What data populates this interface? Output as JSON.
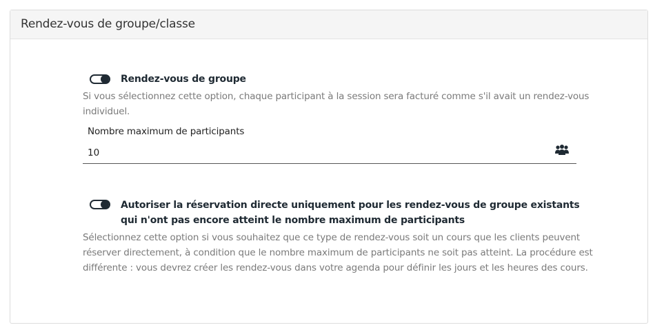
{
  "panel": {
    "title": "Rendez-vous de groupe/classe"
  },
  "group_option": {
    "enabled": true,
    "label": "Rendez-vous de groupe",
    "description_line1": "Si vous sélectionnez cette option, chaque participant à la session sera facturé comme s'il avait un rendez-vous",
    "description_line2": "individuel."
  },
  "max_participants": {
    "label": "Nombre maximum de participants",
    "value": "10",
    "icon": "users-icon"
  },
  "direct_booking_option": {
    "enabled": true,
    "label_line1": "Autoriser la réservation directe uniquement pour les rendez-vous de groupe existants",
    "label_line2": "qui n'ont pas encore atteint le nombre maximum de participants",
    "description_line1": "Sélectionnez cette option si vous souhaitez que ce type de rendez-vous soit un cours que les clients peuvent",
    "description_line2": "réserver directement, à condition que le nombre maximum de participants ne soit pas atteint. La procédure est",
    "description_line3": "différente : vous devrez créer les rendez-vous dans votre agenda pour définir les jours et les heures des cours."
  },
  "colors": {
    "toggle_on": "#1f2a33",
    "description_text": "#7a7a7a",
    "header_bg": "#f5f5f5"
  }
}
